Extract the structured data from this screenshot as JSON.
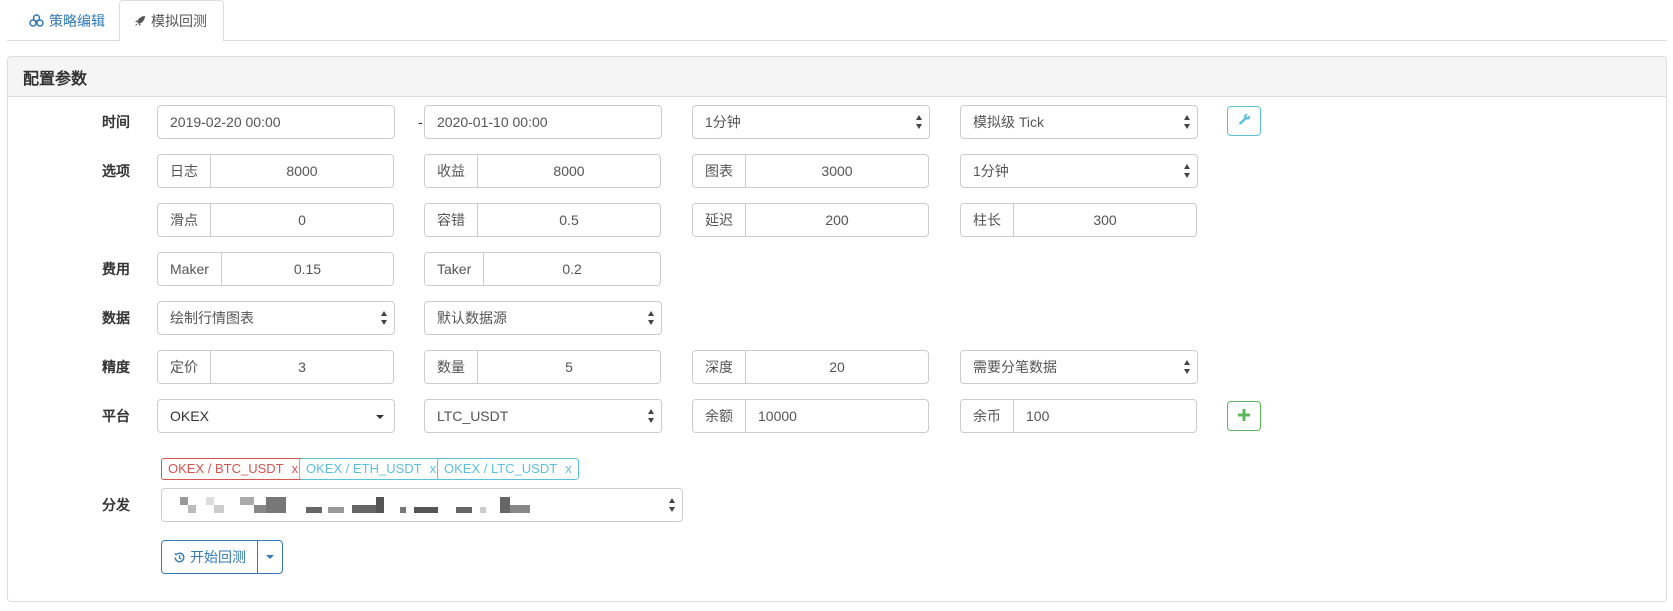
{
  "tabs": [
    {
      "label": "策略编辑",
      "icon": "cubes-icon"
    },
    {
      "label": "模拟回测",
      "icon": "rocket-icon"
    }
  ],
  "panel_title": "配置参数",
  "labels": {
    "time": "时间",
    "options": "选项",
    "fees": "费用",
    "data": "数据",
    "precision": "精度",
    "platform": "平台",
    "dispatch": "分发"
  },
  "time": {
    "start": "2019-02-20 00:00",
    "separator": "-",
    "end": "2020-01-10 00:00",
    "period": "1分钟",
    "mode": "模拟级 Tick"
  },
  "options": {
    "log_label": "日志",
    "log_value": "8000",
    "profit_label": "收益",
    "profit_value": "8000",
    "chart_label": "图表",
    "chart_value": "3000",
    "period2": "1分钟",
    "slippage_label": "滑点",
    "slippage_value": "0",
    "tolerance_label": "容错",
    "tolerance_value": "0.5",
    "delay_label": "延迟",
    "delay_value": "200",
    "bar_label": "柱长",
    "bar_value": "300"
  },
  "fees": {
    "maker_label": "Maker",
    "maker_value": "0.15",
    "taker_label": "Taker",
    "taker_value": "0.2"
  },
  "data": {
    "chart_option": "绘制行情图表",
    "source": "默认数据源"
  },
  "precision": {
    "price_label": "定价",
    "price_value": "3",
    "qty_label": "数量",
    "qty_value": "5",
    "depth_label": "深度",
    "depth_value": "20",
    "tick_option": "需要分笔数据"
  },
  "platform": {
    "exchange": "OKEX",
    "pair": "LTC_USDT",
    "balance_label": "余额",
    "balance_value": "10000",
    "coins_label": "余币",
    "coins_value": "100"
  },
  "pairs": [
    {
      "label": "OKEX / BTC_USDT",
      "remove": "x",
      "color": "#d9534f"
    },
    {
      "label": "OKEX / ETH_USDT",
      "remove": "x",
      "color": "#5bc0de"
    },
    {
      "label": "OKEX / LTC_USDT",
      "remove": "x",
      "color": "#5bc0de"
    }
  ],
  "start_button": "开始回测",
  "colors": {
    "primary": "#337ab7",
    "info": "#5bc0de",
    "success": "#5cb85c",
    "danger": "#d9534f"
  }
}
